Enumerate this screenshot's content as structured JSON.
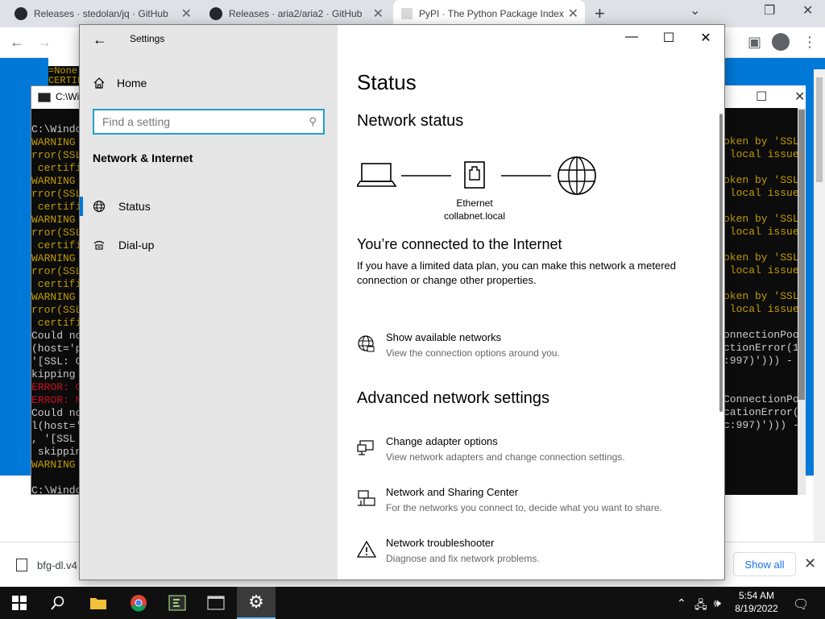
{
  "browser": {
    "tabs": [
      {
        "label": "Releases · stedolan/jq · GitHub"
      },
      {
        "label": "Releases · aria2/aria2 · GitHub"
      },
      {
        "label": "PyPI · The Python Package Index"
      }
    ],
    "download": {
      "filename": "bfg-dl.v4",
      "show_all": "Show all"
    }
  },
  "console_left": {
    "title": "C:\\Wi",
    "lines": [
      {
        "text": "C:\\Windo",
        "kind": "normal"
      },
      {
        "text": "WARNING",
        "kind": "warn"
      },
      {
        "text": "rror(SSL",
        "kind": "warn"
      },
      {
        "text": " certifi",
        "kind": "warn"
      },
      {
        "text": "WARNING",
        "kind": "warn"
      },
      {
        "text": "rror(SSL",
        "kind": "warn"
      },
      {
        "text": " certifi",
        "kind": "warn"
      },
      {
        "text": "WARNING",
        "kind": "warn"
      },
      {
        "text": "rror(SSL",
        "kind": "warn"
      },
      {
        "text": " certifi",
        "kind": "warn"
      },
      {
        "text": "WARNING",
        "kind": "warn"
      },
      {
        "text": "rror(SSL",
        "kind": "warn"
      },
      {
        "text": " certifi",
        "kind": "warn"
      },
      {
        "text": "WARNING",
        "kind": "warn"
      },
      {
        "text": "rror(SSL",
        "kind": "warn"
      },
      {
        "text": " certifi",
        "kind": "warn"
      },
      {
        "text": "Could no",
        "kind": "normal"
      },
      {
        "text": "(host='p",
        "kind": "normal"
      },
      {
        "text": "'[SSL: C",
        "kind": "normal"
      },
      {
        "text": "kipping",
        "kind": "normal"
      },
      {
        "text": "ERROR: C",
        "kind": "error"
      },
      {
        "text": "ERROR: N",
        "kind": "error"
      },
      {
        "text": "Could no",
        "kind": "normal"
      },
      {
        "text": "l(host='",
        "kind": "normal"
      },
      {
        "text": ", '[SSL",
        "kind": "normal"
      },
      {
        "text": " skippin",
        "kind": "normal"
      },
      {
        "text": "WARNING",
        "kind": "warn"
      },
      {
        "text": "",
        "kind": "normal"
      },
      {
        "text": "C:\\Windo",
        "kind": "normal"
      }
    ],
    "top_fragments": [
      "=None)",
      "CERTIF"
    ],
    "top_title": "C:"
  },
  "console_right": {
    "lines": [
      {
        "text": "oken by 'SSLE",
        "kind": "warn"
      },
      {
        "text": " local issuer",
        "kind": "warn"
      },
      {
        "text": "",
        "kind": "normal"
      },
      {
        "text": "oken by 'SSLE",
        "kind": "warn"
      },
      {
        "text": " local issuer",
        "kind": "warn"
      },
      {
        "text": "",
        "kind": "normal"
      },
      {
        "text": "oken by 'SSLE",
        "kind": "warn"
      },
      {
        "text": " local issuer",
        "kind": "warn"
      },
      {
        "text": "",
        "kind": "normal"
      },
      {
        "text": "oken by 'SSLE",
        "kind": "warn"
      },
      {
        "text": " local issuer",
        "kind": "warn"
      },
      {
        "text": "",
        "kind": "normal"
      },
      {
        "text": "oken by 'SSLE",
        "kind": "warn"
      },
      {
        "text": " local issuer",
        "kind": "warn"
      },
      {
        "text": "",
        "kind": "normal"
      },
      {
        "text": "onnectionPool",
        "kind": "normal"
      },
      {
        "text": "ctionError(1,",
        "kind": "normal"
      },
      {
        "text": ":997)'))) - s",
        "kind": "normal"
      },
      {
        "text": "",
        "kind": "normal"
      },
      {
        "text": "",
        "kind": "normal"
      },
      {
        "text": "ConnectionPoo",
        "kind": "normal"
      },
      {
        "text": "cationError(1",
        "kind": "normal"
      },
      {
        "text": "c:997)'))) -",
        "kind": "normal"
      }
    ]
  },
  "settings": {
    "window_title": "Settings",
    "home": "Home",
    "search_placeholder": "Find a setting",
    "section": "Network & Internet",
    "nav": [
      {
        "label": "Status",
        "icon": "globe-icon",
        "active": true
      },
      {
        "label": "Dial-up",
        "icon": "dialup-icon",
        "active": false
      }
    ],
    "page_title": "Status",
    "network_status_title": "Network status",
    "adapter_name": "Ethernet",
    "adapter_domain": "collabnet.local",
    "connected_title": "You’re connected to the Internet",
    "connected_desc": "If you have a limited data plan, you can make this network a metered connection or change other properties.",
    "show_networks": {
      "title": "Show available networks",
      "desc": "View the connection options around you."
    },
    "advanced_title": "Advanced network settings",
    "advanced": [
      {
        "title": "Change adapter options",
        "desc": "View network adapters and change connection settings.",
        "icon": "adapter-icon"
      },
      {
        "title": "Network and Sharing Center",
        "desc": "For the networks you connect to, decide what you want to share.",
        "icon": "sharing-icon"
      },
      {
        "title": "Network troubleshooter",
        "desc": "Diagnose and fix network problems.",
        "icon": "warning-icon"
      }
    ]
  },
  "taskbar": {
    "time": "5:54 AM",
    "date": "8/19/2022"
  }
}
